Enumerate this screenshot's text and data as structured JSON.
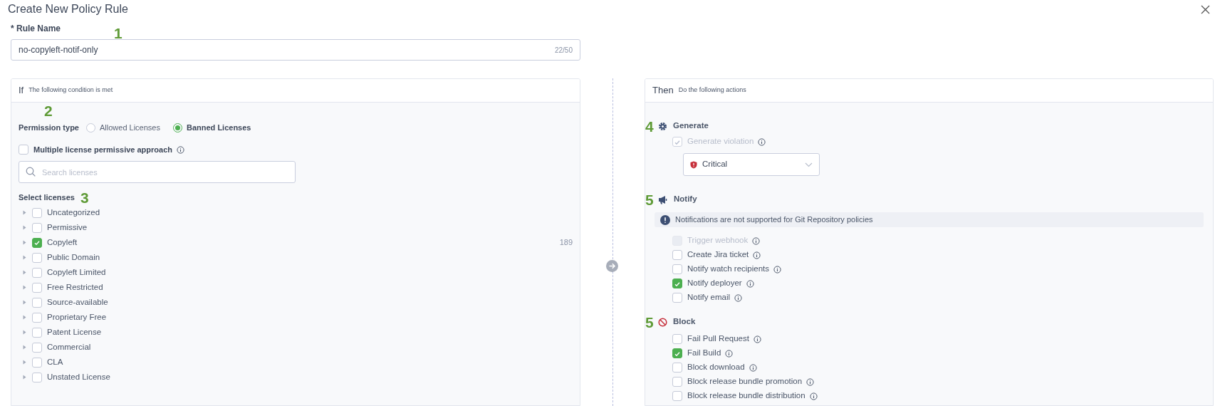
{
  "dialog": {
    "title": "Create New Policy Rule"
  },
  "rule_name": {
    "label": "* Rule Name",
    "marker": "1",
    "value": "no-copyleft-notif-only",
    "counter": "22/50"
  },
  "condition": {
    "heading": "If",
    "subheading": "The following condition is met",
    "marker": "2",
    "permission_type": {
      "label": "Permission type",
      "options": [
        {
          "label": "Allowed Licenses",
          "selected": false
        },
        {
          "label": "Banned Licenses",
          "selected": true
        }
      ]
    },
    "multiple_approach": {
      "label": "Multiple license permissive approach",
      "checked": false
    },
    "search": {
      "placeholder": "Search licenses"
    },
    "licenses": {
      "label": "Select licenses",
      "marker": "3",
      "items": [
        {
          "label": "Uncategorized",
          "checked": false
        },
        {
          "label": "Permissive",
          "checked": false
        },
        {
          "label": "Copyleft",
          "checked": true,
          "count": "189"
        },
        {
          "label": "Public Domain",
          "checked": false
        },
        {
          "label": "Copyleft Limited",
          "checked": false
        },
        {
          "label": "Free Restricted",
          "checked": false
        },
        {
          "label": "Source-available",
          "checked": false
        },
        {
          "label": "Proprietary Free",
          "checked": false
        },
        {
          "label": "Patent License",
          "checked": false
        },
        {
          "label": "Commercial",
          "checked": false
        },
        {
          "label": "CLA",
          "checked": false
        },
        {
          "label": "Unstated License",
          "checked": false
        }
      ]
    }
  },
  "actions": {
    "heading": "Then",
    "subheading": "Do the following actions",
    "groups": [
      {
        "kind": "generate",
        "title": "Generate",
        "marker": "4",
        "items": [
          {
            "label": "Generate violation",
            "checked": true,
            "disabled": true
          }
        ],
        "severity": "Critical"
      },
      {
        "kind": "notify",
        "title": "Notify",
        "marker": "5",
        "notice": "Notifications are not supported for Git Repository policies",
        "items": [
          {
            "label": "Trigger webhook",
            "checked": false,
            "disabled": true
          },
          {
            "label": "Create Jira ticket",
            "checked": false,
            "disabled": false
          },
          {
            "label": "Notify watch recipients",
            "checked": false,
            "disabled": false
          },
          {
            "label": "Notify deployer",
            "checked": true,
            "disabled": false
          },
          {
            "label": "Notify email",
            "checked": false,
            "disabled": false
          }
        ]
      },
      {
        "kind": "block",
        "title": "Block",
        "marker": "5",
        "items": [
          {
            "label": "Fail Pull Request",
            "checked": false,
            "disabled": false
          },
          {
            "label": "Fail Build",
            "checked": true,
            "disabled": false
          },
          {
            "label": "Block download",
            "checked": false,
            "disabled": false
          },
          {
            "label": "Block release bundle promotion",
            "checked": false,
            "disabled": false
          },
          {
            "label": "Block release bundle distribution",
            "checked": false,
            "disabled": false
          }
        ]
      }
    ]
  }
}
